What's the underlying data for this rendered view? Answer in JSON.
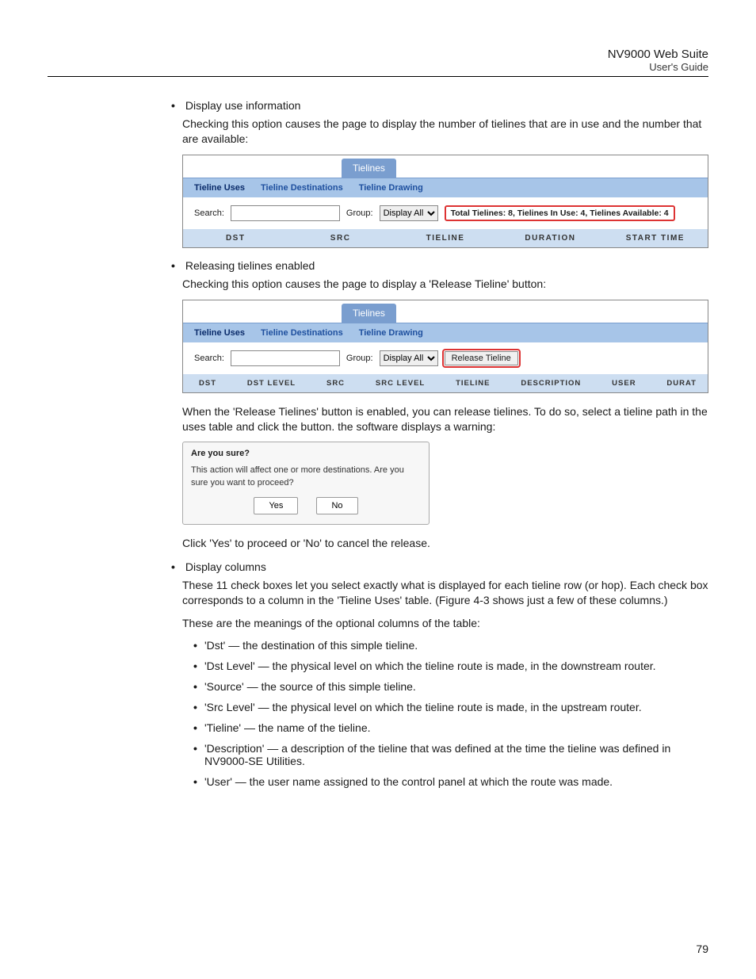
{
  "header": {
    "product": "NV9000 Web Suite",
    "guide": "User's Guide"
  },
  "bullets": {
    "display_use_info": {
      "title": "Display use information",
      "desc": "Checking this option causes the page to display the number of tielines that are in use and the number that are available:"
    },
    "releasing": {
      "title": "Releasing tielines enabled",
      "desc": "Checking this option causes the page to display a 'Release Tieline' button:",
      "after1": "When the 'Release Tielines' button is enabled, you can release tielines. To do so, select a tieline path in the uses table and click the button. the software displays a warning:",
      "after2": "Click 'Yes' to proceed or 'No' to cancel the release."
    },
    "display_cols": {
      "title": "Display columns",
      "desc1": "These 11 check boxes let you select exactly what is displayed for each tieline row (or hop). Each check box corresponds to a column in the 'Tieline Uses' table. (Figure 4-3 shows just a few of these columns.)",
      "desc2": "These are the meanings of the optional columns of the table:",
      "items": {
        "dst": "'Dst' — the destination of this simple tieline.",
        "dst_level": "'Dst Level' — the physical level on which the tieline route is made, in the downstream router.",
        "source": "'Source' — the source of this simple tieline.",
        "src_level": "'Src Level' — the physical level on which the tieline route is made, in the upstream router.",
        "tieline": "'Tieline' — the name of the tieline.",
        "description": "'Description' — a description of the tieline that was defined at the time the tieline was defined in NV9000-SE Utilities.",
        "user": "'User' — the user name assigned to the control panel at which the route was made."
      }
    }
  },
  "fig1": {
    "maintab": "Tielines",
    "subtabs": {
      "uses": "Tieline Uses",
      "dests": "Tieline Destinations",
      "drawing": "Tieline Drawing"
    },
    "search_label": "Search:",
    "group_label": "Group:",
    "group_value": "Display All",
    "info": "Total Tielines: 8, Tielines In Use: 4, Tielines Available: 4",
    "cols": {
      "dst": "DST",
      "src": "SRC",
      "tieline": "TIELINE",
      "duration": "DURATION",
      "start": "START TIME"
    }
  },
  "fig2": {
    "maintab": "Tielines",
    "subtabs": {
      "uses": "Tieline Uses",
      "dests": "Tieline Destinations",
      "drawing": "Tieline Drawing"
    },
    "search_label": "Search:",
    "group_label": "Group:",
    "group_value": "Display All",
    "release_btn": "Release Tieline",
    "cols": {
      "dst": "DST",
      "dstlvl": "DST LEVEL",
      "src": "SRC",
      "srclvl": "SRC LEVEL",
      "tieline": "TIELINE",
      "desc": "DESCRIPTION",
      "user": "USER",
      "durat": "DURAT"
    }
  },
  "dialog": {
    "title": "Are you sure?",
    "body": "This action will affect one or more destinations. Are you sure you want to proceed?",
    "yes": "Yes",
    "no": "No"
  },
  "page_number": "79"
}
